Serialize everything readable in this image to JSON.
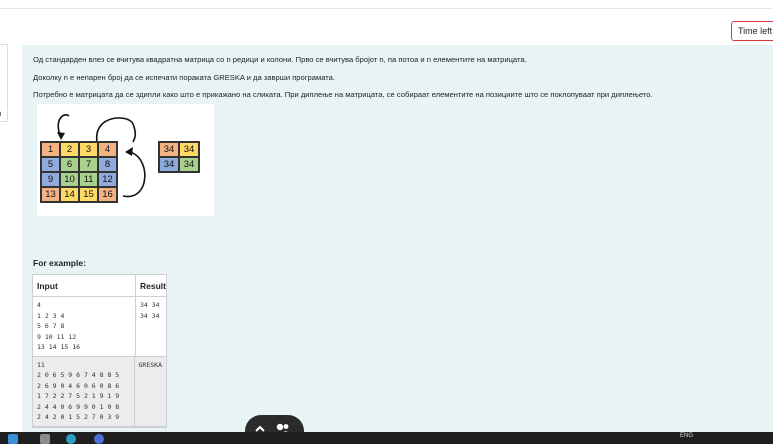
{
  "header": {
    "timer_label": "Time left"
  },
  "question": {
    "paragraphs": [
      "Од стандарден влез се вчитува квадратна матрица со n редици и колони. Прво се вчитува бројот n, па потоа и n елементите на матрицата.",
      "Доколку n е непарен број да се испечати пораката GRESKA и да заврши програмата.",
      "Потребно е матрицата да се здипли како што е прикажано на сликата. При диплење на матрицата, се собираат елементите на позициите што се поклопуваат при диплењето."
    ],
    "figure": {
      "matrix": [
        [
          "1",
          "2",
          "3",
          "4"
        ],
        [
          "5",
          "6",
          "7",
          "8"
        ],
        [
          "9",
          "10",
          "11",
          "12"
        ],
        [
          "13",
          "14",
          "15",
          "16"
        ]
      ],
      "result": [
        [
          "34",
          "34"
        ],
        [
          "34",
          "34"
        ]
      ]
    },
    "example": {
      "title": "For example:",
      "headers": {
        "input": "Input",
        "result": "Result"
      },
      "rows": [
        {
          "input_lines": [
            "4",
            "1 2 3 4",
            "5 6 7 8",
            "9 10 11 12",
            "13 14 15 16"
          ],
          "result_lines": [
            "34 34",
            "34 34"
          ]
        },
        {
          "input_lines": [
            "11",
            "2 0 6 5 9 6 7 4 8 8 5",
            "2 6 9 0 4 6 0 6 0 8 6",
            "1 7 2 2 7 5 2 1 9 1 9",
            "2 4 4 0 6 9 9 0 1 0 8",
            "2 4 2 0 1 5 2 7 0 3 9"
          ],
          "result_lines": [
            "GRESKA"
          ]
        }
      ]
    }
  },
  "taskbar": {
    "tray_text": "ENG"
  },
  "colors": {
    "orange": "#f4b183",
    "yellow": "#ffd966",
    "green": "#a9d18e",
    "blue": "#8faadc",
    "question_bg": "#e7f3f5"
  },
  "icons": [
    "chevron-up-icon",
    "users-icon",
    "windows-start-icon",
    "search-icon",
    "edge-icon",
    "chrome-icon"
  ]
}
